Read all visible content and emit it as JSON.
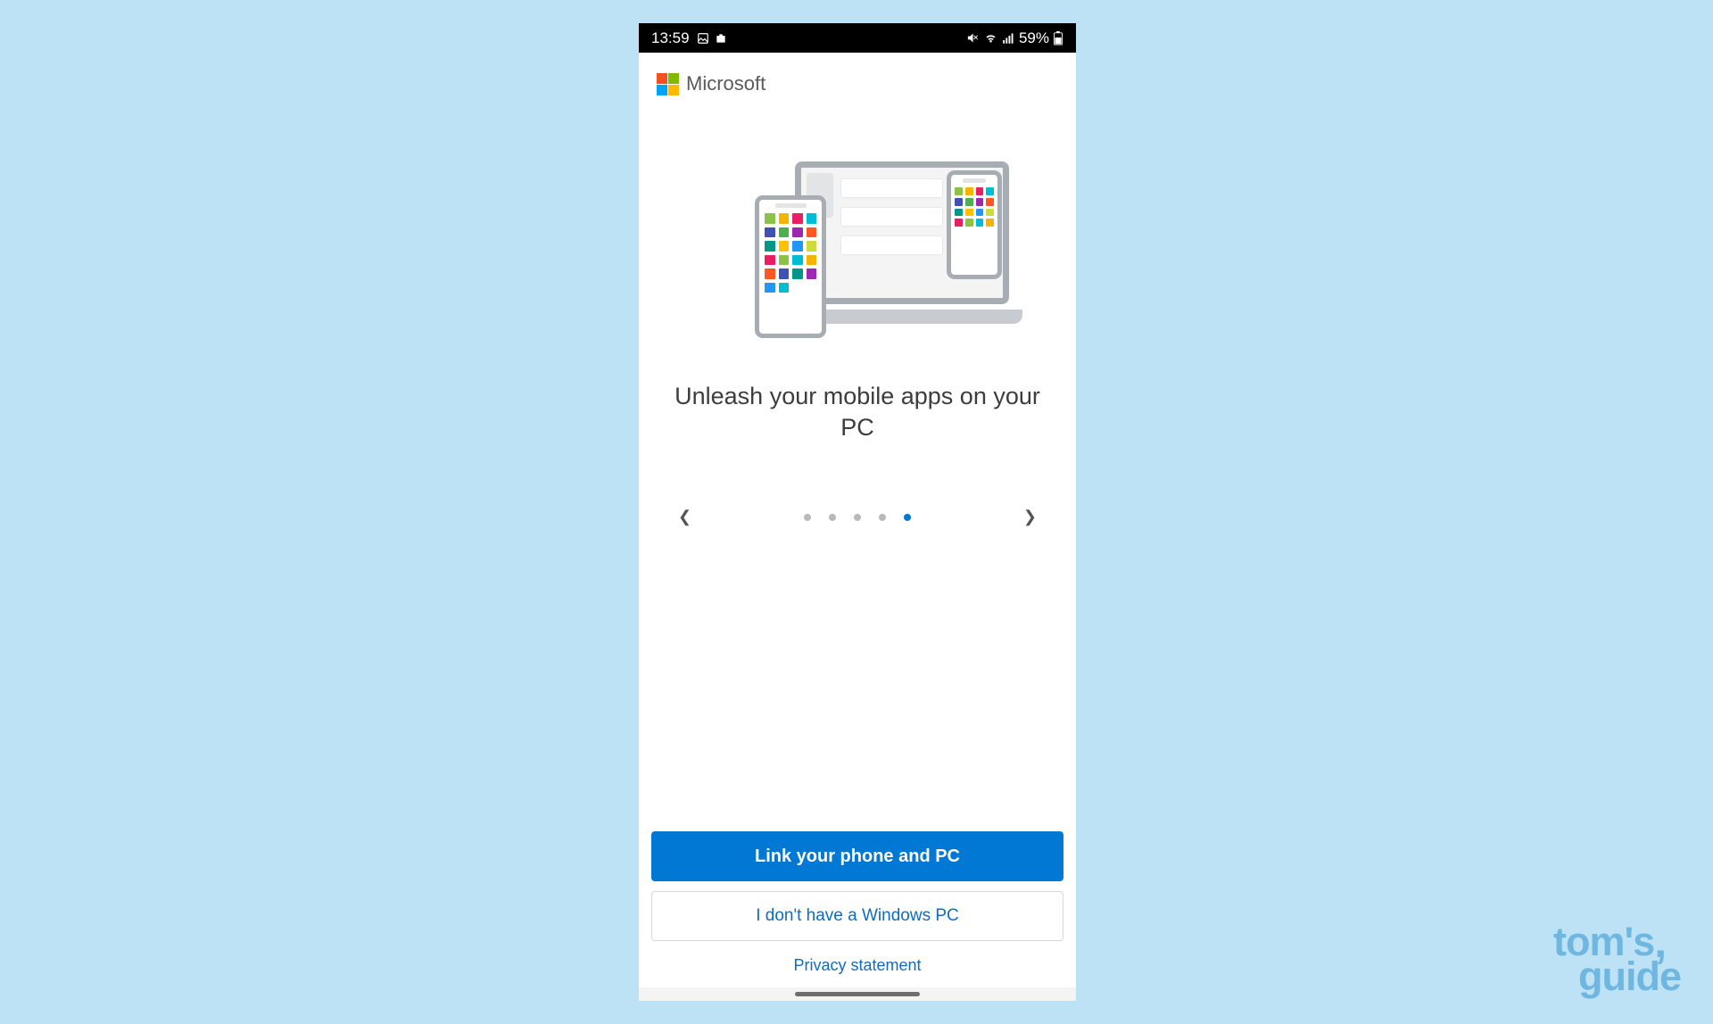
{
  "status_bar": {
    "time": "13:59",
    "battery_text": "59%"
  },
  "header": {
    "brand": "Microsoft"
  },
  "onboarding": {
    "headline": "Unleash your mobile apps on your PC",
    "current_page_index": 4,
    "total_pages": 5
  },
  "actions": {
    "primary": "Link your phone and PC",
    "secondary": "I don't have a Windows PC",
    "privacy": "Privacy statement"
  },
  "watermark": {
    "line1": "tom's",
    "line2": "guide"
  }
}
